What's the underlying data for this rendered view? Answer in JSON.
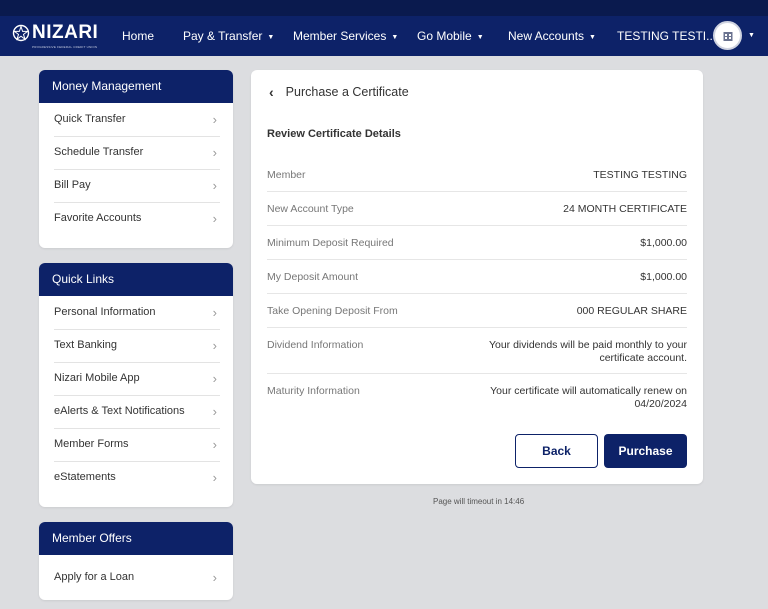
{
  "brand": {
    "name": "NIZARI",
    "tagline": "PROGRESSIVE FEDERAL CREDIT UNION"
  },
  "nav": {
    "home": "Home",
    "pay_transfer": "Pay & Transfer",
    "member_services": "Member Services",
    "go_mobile": "Go Mobile",
    "new_accounts": "New Accounts",
    "user_name": "TESTING TESTI..."
  },
  "sidebar": {
    "money_management": {
      "title": "Money Management",
      "items": [
        "Quick Transfer",
        "Schedule Transfer",
        "Bill Pay",
        "Favorite Accounts"
      ]
    },
    "quick_links": {
      "title": "Quick Links",
      "items": [
        "Personal Information",
        "Text Banking",
        "Nizari Mobile App",
        "eAlerts & Text Notifications",
        "Member Forms",
        "eStatements"
      ]
    },
    "member_offers": {
      "title": "Member Offers",
      "items": [
        "Apply for a Loan"
      ]
    }
  },
  "main": {
    "title": "Purchase a Certificate",
    "section_title": "Review Certificate Details",
    "details": [
      {
        "label": "Member",
        "value": "TESTING TESTING"
      },
      {
        "label": "New Account Type",
        "value": "24 MONTH CERTIFICATE"
      },
      {
        "label": "Minimum Deposit Required",
        "value": "$1,000.00"
      },
      {
        "label": "My Deposit Amount",
        "value": "$1,000.00"
      },
      {
        "label": "Take Opening Deposit From",
        "value": "000 REGULAR SHARE"
      },
      {
        "label": "Dividend Information",
        "value_line1": "Your dividends will be paid monthly to your",
        "value_line2": "certificate account."
      },
      {
        "label": "Maturity Information",
        "value_line1": "Your certificate will automatically renew on",
        "value_line2": "04/20/2024"
      }
    ],
    "back_label": "Back",
    "purchase_label": "Purchase"
  },
  "timeout_text": "Page will timeout in 14:46",
  "colors": {
    "navy": "#0d2268",
    "top_strip": "#0a1a4e",
    "background": "#dcdde0"
  }
}
